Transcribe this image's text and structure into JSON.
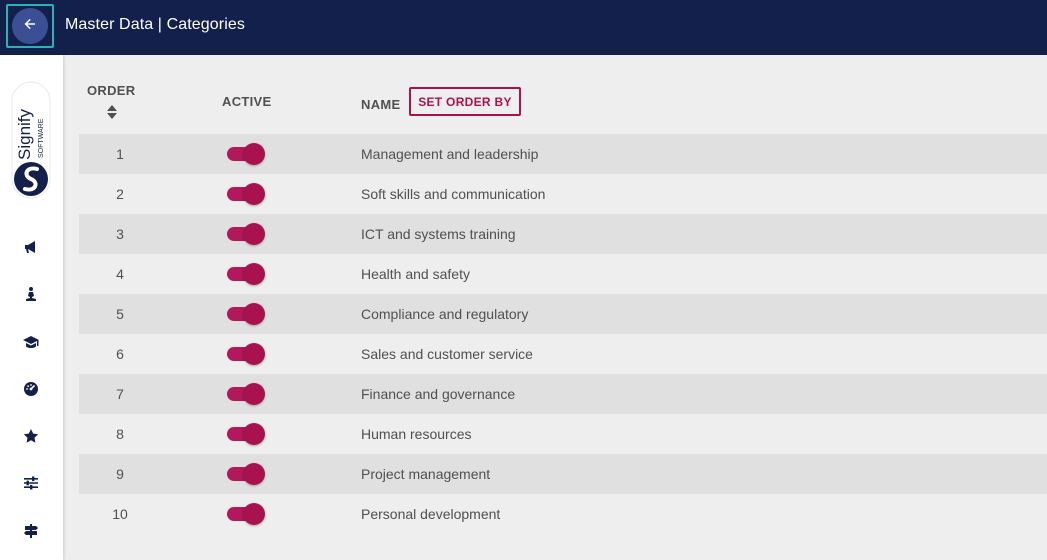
{
  "header": {
    "title": "Master Data | Categories",
    "back_icon": "arrow-left-icon"
  },
  "sidebar": {
    "logo": {
      "wordmark": "Signify",
      "subtext": "SOFTWARE"
    },
    "items": [
      {
        "icon": "megaphone-icon"
      },
      {
        "icon": "person-meditate-icon"
      },
      {
        "icon": "graduation-cap-icon"
      },
      {
        "icon": "dashboard-gauge-icon"
      },
      {
        "icon": "star-icon"
      },
      {
        "icon": "sliders-icon"
      },
      {
        "icon": "signpost-icon"
      }
    ]
  },
  "table": {
    "columns": {
      "order": "ORDER",
      "active": "ACTIVE",
      "name": "NAME"
    },
    "set_order_label": "SET ORDER BY",
    "rows": [
      {
        "order": "1",
        "active": true,
        "name": "Management and leadership"
      },
      {
        "order": "2",
        "active": true,
        "name": "Soft skills and communication"
      },
      {
        "order": "3",
        "active": true,
        "name": "ICT and systems training"
      },
      {
        "order": "4",
        "active": true,
        "name": "Health and safety"
      },
      {
        "order": "5",
        "active": true,
        "name": "Compliance and regulatory"
      },
      {
        "order": "6",
        "active": true,
        "name": "Sales and customer service"
      },
      {
        "order": "7",
        "active": true,
        "name": "Finance and governance"
      },
      {
        "order": "8",
        "active": true,
        "name": "Human resources"
      },
      {
        "order": "9",
        "active": true,
        "name": "Project management"
      },
      {
        "order": "10",
        "active": true,
        "name": "Personal development"
      }
    ]
  },
  "colors": {
    "header_bg": "#13204b",
    "accent": "#a8134f",
    "focus_outline": "#2bb3b3",
    "text": "#505050"
  }
}
